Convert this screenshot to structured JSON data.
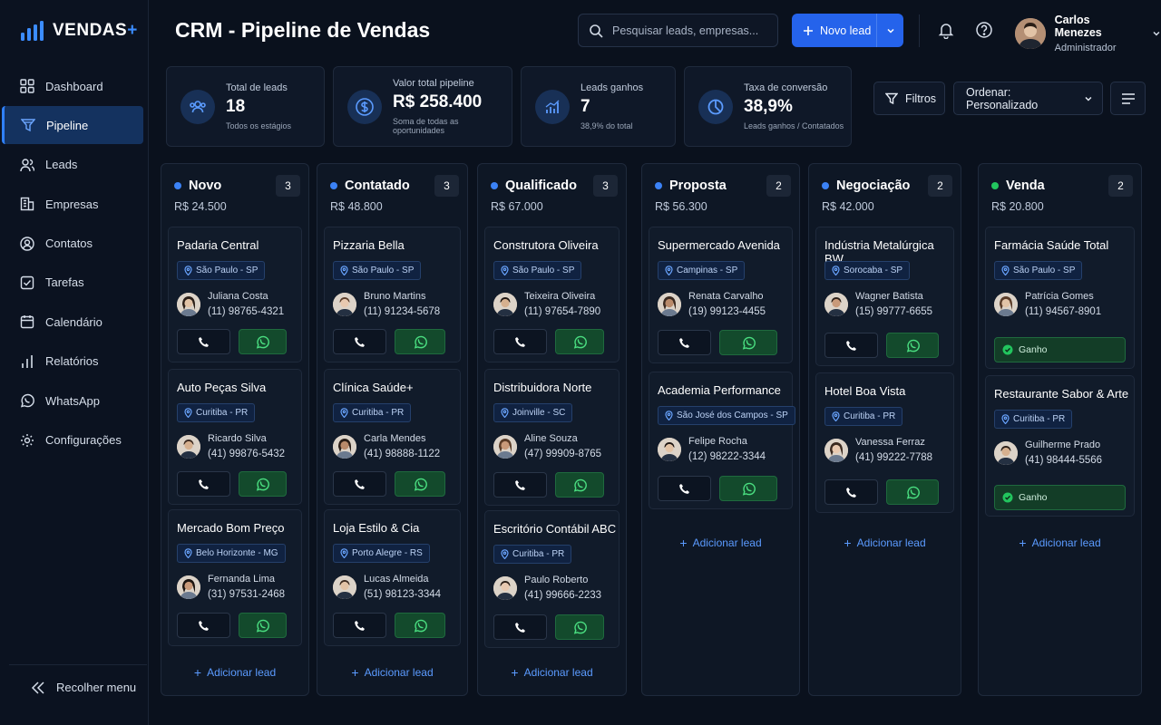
{
  "app": {
    "logo_text": "VENDAS",
    "logo_plus": "+",
    "accent": "#2563eb"
  },
  "sidebar": {
    "items": [
      {
        "label": "Dashboard",
        "icon": "dashboard-icon"
      },
      {
        "label": "Pipeline",
        "icon": "funnel-icon",
        "active": true
      },
      {
        "label": "Leads",
        "icon": "users-icon"
      },
      {
        "label": "Empresas",
        "icon": "building-icon"
      },
      {
        "label": "Contatos",
        "icon": "contact-icon"
      },
      {
        "label": "Tarefas",
        "icon": "checkbox-icon"
      },
      {
        "label": "Calendário",
        "icon": "calendar-icon"
      },
      {
        "label": "Relatórios",
        "icon": "bar-chart-icon"
      },
      {
        "label": "WhatsApp",
        "icon": "whatsapp-icon"
      },
      {
        "label": "Configurações",
        "icon": "gear-icon"
      }
    ],
    "collapse_label": "Recolher menu"
  },
  "header": {
    "title": "CRM - Pipeline de Vendas",
    "search_placeholder": "Pesquisar leads, empresas...",
    "new_lead_label": "Novo lead",
    "user": {
      "name": "Carlos Menezes",
      "role": "Administrador"
    }
  },
  "stats": [
    {
      "label": "Total de leads",
      "value": "18",
      "sub": "Todos os estágios",
      "icon": "users-icon"
    },
    {
      "label": "Valor total pipeline",
      "value": "R$ 258.400",
      "sub": "Soma de todas as oportunidades",
      "icon": "dollar-icon"
    },
    {
      "label": "Leads ganhos",
      "value": "7",
      "sub": "38,9% do total",
      "icon": "chart-icon"
    },
    {
      "label": "Taxa de conversão",
      "value": "38,9%",
      "sub": "Leads ganhos / Contatados",
      "icon": "pie-icon"
    }
  ],
  "toolbar": {
    "filters_label": "Filtros",
    "sort_label": "Ordenar: Personalizado"
  },
  "add_lead_label": "Adicionar lead",
  "won_label": "Ganho",
  "columns": [
    {
      "title": "Novo",
      "count": "3",
      "total": "R$ 24.500",
      "color": "#3b82f6",
      "cards": [
        {
          "title": "Padaria Central",
          "location": "São Paulo - SP",
          "contact": "Juliana Costa",
          "phone": "(11) 98765-4321"
        },
        {
          "title": "Auto Peças Silva",
          "location": "Curitiba - PR",
          "contact": "Ricardo Silva",
          "phone": "(41) 99876-5432"
        },
        {
          "title": "Mercado Bom Preço",
          "location": "Belo Horizonte - MG",
          "contact": "Fernanda Lima",
          "phone": "(31) 97531-2468"
        }
      ]
    },
    {
      "title": "Contatado",
      "count": "3",
      "total": "R$ 48.800",
      "color": "#3b82f6",
      "cards": [
        {
          "title": "Pizzaria Bella",
          "location": "São Paulo - SP",
          "contact": "Bruno Martins",
          "phone": "(11) 91234-5678"
        },
        {
          "title": "Clínica Saúde+",
          "location": "Curitiba - PR",
          "contact": "Carla Mendes",
          "phone": "(41) 98888-1122"
        },
        {
          "title": "Loja Estilo & Cia",
          "location": "Porto Alegre - RS",
          "contact": "Lucas Almeida",
          "phone": "(51) 98123-3344"
        }
      ]
    },
    {
      "title": "Qualificado",
      "count": "3",
      "total": "R$ 67.000",
      "color": "#3b82f6",
      "cards": [
        {
          "title": "Construtora Oliveira",
          "location": "São Paulo - SP",
          "contact": "Teixeira Oliveira",
          "phone": "(11) 97654-7890"
        },
        {
          "title": "Distribuidora Norte",
          "location": "Joinville - SC",
          "contact": "Aline Souza",
          "phone": "(47) 99909-8765"
        },
        {
          "title": "Escritório Contábil ABC",
          "location": "Curitiba - PR",
          "contact": "Paulo Roberto",
          "phone": "(41) 99666-2233"
        }
      ]
    },
    {
      "title": "Proposta",
      "count": "2",
      "total": "R$ 56.300",
      "color": "#3b82f6",
      "cards": [
        {
          "title": "Supermercado Avenida",
          "location": "Campinas - SP",
          "contact": "Renata Carvalho",
          "phone": "(19) 99123-4455"
        },
        {
          "title": "Academia Performance",
          "location": "São José dos Campos - SP",
          "contact": "Felipe Rocha",
          "phone": "(12) 98222-3344"
        }
      ]
    },
    {
      "title": "Negociação",
      "count": "2",
      "total": "R$ 42.000",
      "color": "#3b82f6",
      "cards": [
        {
          "title": "Indústria Metalúrgica BW",
          "location": "Sorocaba - SP",
          "contact": "Wagner Batista",
          "phone": "(15) 99777-6655"
        },
        {
          "title": "Hotel Boa Vista",
          "location": "Curitiba - PR",
          "contact": "Vanessa Ferraz",
          "phone": "(41) 99222-7788"
        }
      ]
    },
    {
      "title": "Venda",
      "count": "2",
      "total": "R$ 20.800",
      "color": "#22c55e",
      "cards": [
        {
          "title": "Farmácia Saúde Total",
          "location": "São Paulo - SP",
          "contact": "Patrícia Gomes",
          "phone": "(11) 94567-8901",
          "won": true
        },
        {
          "title": "Restaurante Sabor & Arte",
          "location": "Curitiba - PR",
          "contact": "Guilherme Prado",
          "phone": "(41) 98444-5566",
          "won": true
        }
      ]
    }
  ]
}
